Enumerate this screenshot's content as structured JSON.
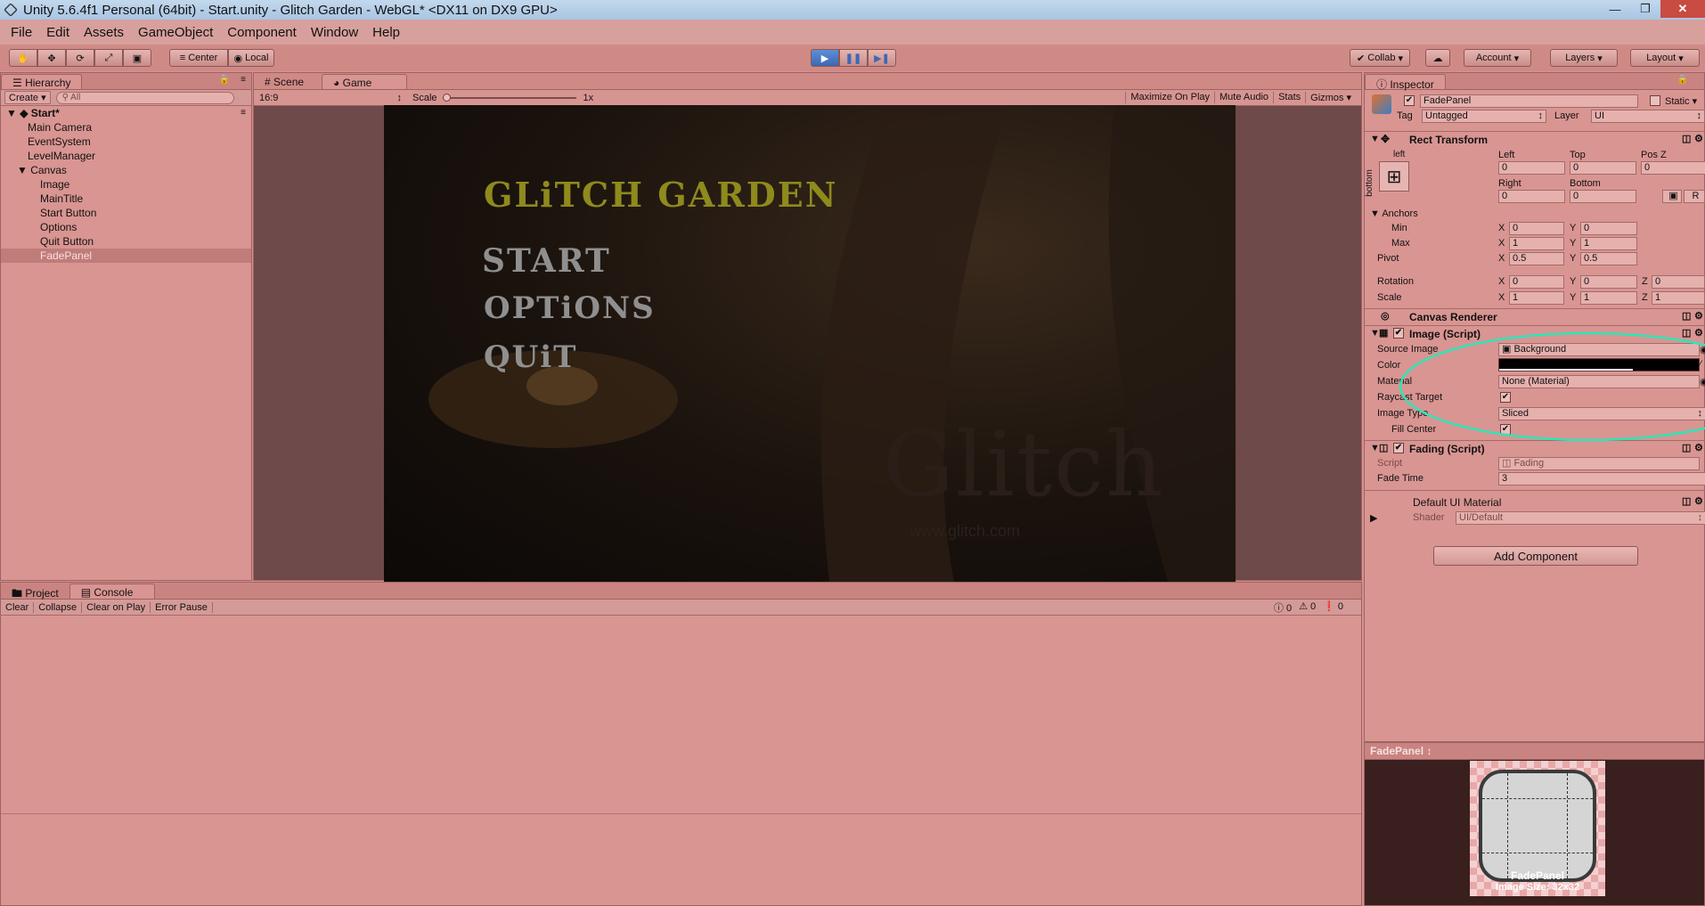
{
  "window": {
    "title": "Unity 5.6.4f1 Personal (64bit) - Start.unity - Glitch Garden - WebGL* <DX11 on DX9 GPU>"
  },
  "menu": [
    "File",
    "Edit",
    "Assets",
    "GameObject",
    "Component",
    "Window",
    "Help"
  ],
  "toolbar": {
    "pivot": "Center",
    "space": "Local",
    "collab": "Collab",
    "account": "Account",
    "layers": "Layers",
    "layout": "Layout"
  },
  "hierarchy": {
    "tab": "Hierarchy",
    "create": "Create",
    "search_placeholder": "All",
    "scene": "Start*",
    "items": [
      "Main Camera",
      "EventSystem",
      "LevelManager",
      "Canvas",
      "Image",
      "MainTitle",
      "Start Button",
      "Options",
      "Quit Button",
      "FadePanel"
    ]
  },
  "game": {
    "tabs": [
      "Scene",
      "Game"
    ],
    "aspect": "16:9",
    "scale_label": "Scale",
    "scale_value": "1x",
    "options": [
      "Maximize On Play",
      "Mute Audio",
      "Stats",
      "Gizmos"
    ],
    "title": "GLiTCH GARDEN",
    "menu": [
      "START",
      "OPTiONS",
      "QUiT"
    ],
    "watermark": "Glitch",
    "watermark_url": "www.glitch.com"
  },
  "console": {
    "tabs": [
      "Project",
      "Console"
    ],
    "buttons": [
      "Clear",
      "Collapse",
      "Clear on Play",
      "Error Pause"
    ],
    "counts": [
      "0",
      "0",
      "0"
    ]
  },
  "inspector": {
    "tab": "Inspector",
    "object_name": "FadePanel",
    "static": "Static",
    "tag_label": "Tag",
    "tag": "Untagged",
    "layer_label": "Layer",
    "layer": "UI",
    "rect_transform": "Rect Transform",
    "anchor_h": "left",
    "anchor_v": "bottom",
    "left_label": "Left",
    "left": "0",
    "top_label": "Top",
    "top": "0",
    "posz_label": "Pos Z",
    "posz": "0",
    "right_label": "Right",
    "right": "0",
    "bottom_label": "Bottom",
    "bottom": "0",
    "r_button": "R",
    "anchors": "Anchors",
    "min": "Min",
    "min_x": "0",
    "min_y": "0",
    "max": "Max",
    "max_x": "1",
    "max_y": "1",
    "pivot": "Pivot",
    "pivot_x": "0.5",
    "pivot_y": "0.5",
    "rotation": "Rotation",
    "rot_x": "0",
    "rot_y": "0",
    "rot_z": "0",
    "scale": "Scale",
    "scale_x": "1",
    "scale_y": "1",
    "scale_z": "1",
    "canvas_renderer": "Canvas Renderer",
    "image_script": "Image (Script)",
    "source_image_label": "Source Image",
    "source_image": "Background",
    "color_label": "Color",
    "color_value": "#000000",
    "material_label": "Material",
    "material": "None (Material)",
    "raycast_label": "Raycast Target",
    "image_type_label": "Image Type",
    "image_type": "Sliced",
    "fill_center_label": "Fill Center",
    "fading_script": "Fading (Script)",
    "script_label": "Script",
    "script": "Fading",
    "fade_time_label": "Fade Time",
    "fade_time": "3",
    "default_material": "Default UI Material",
    "shader_label": "Shader",
    "shader": "UI/Default",
    "add_component": "Add Component",
    "axis_x": "X",
    "axis_y": "Y",
    "axis_z": "Z"
  },
  "preview": {
    "title": "FadePanel",
    "caption_name": "FadePanel",
    "caption_size": "Image Size: 32x32"
  },
  "colors": {
    "editor_tint": "#d99592",
    "play_button": "#4a7cc8",
    "annotation_circle": "#2ee6b8"
  }
}
